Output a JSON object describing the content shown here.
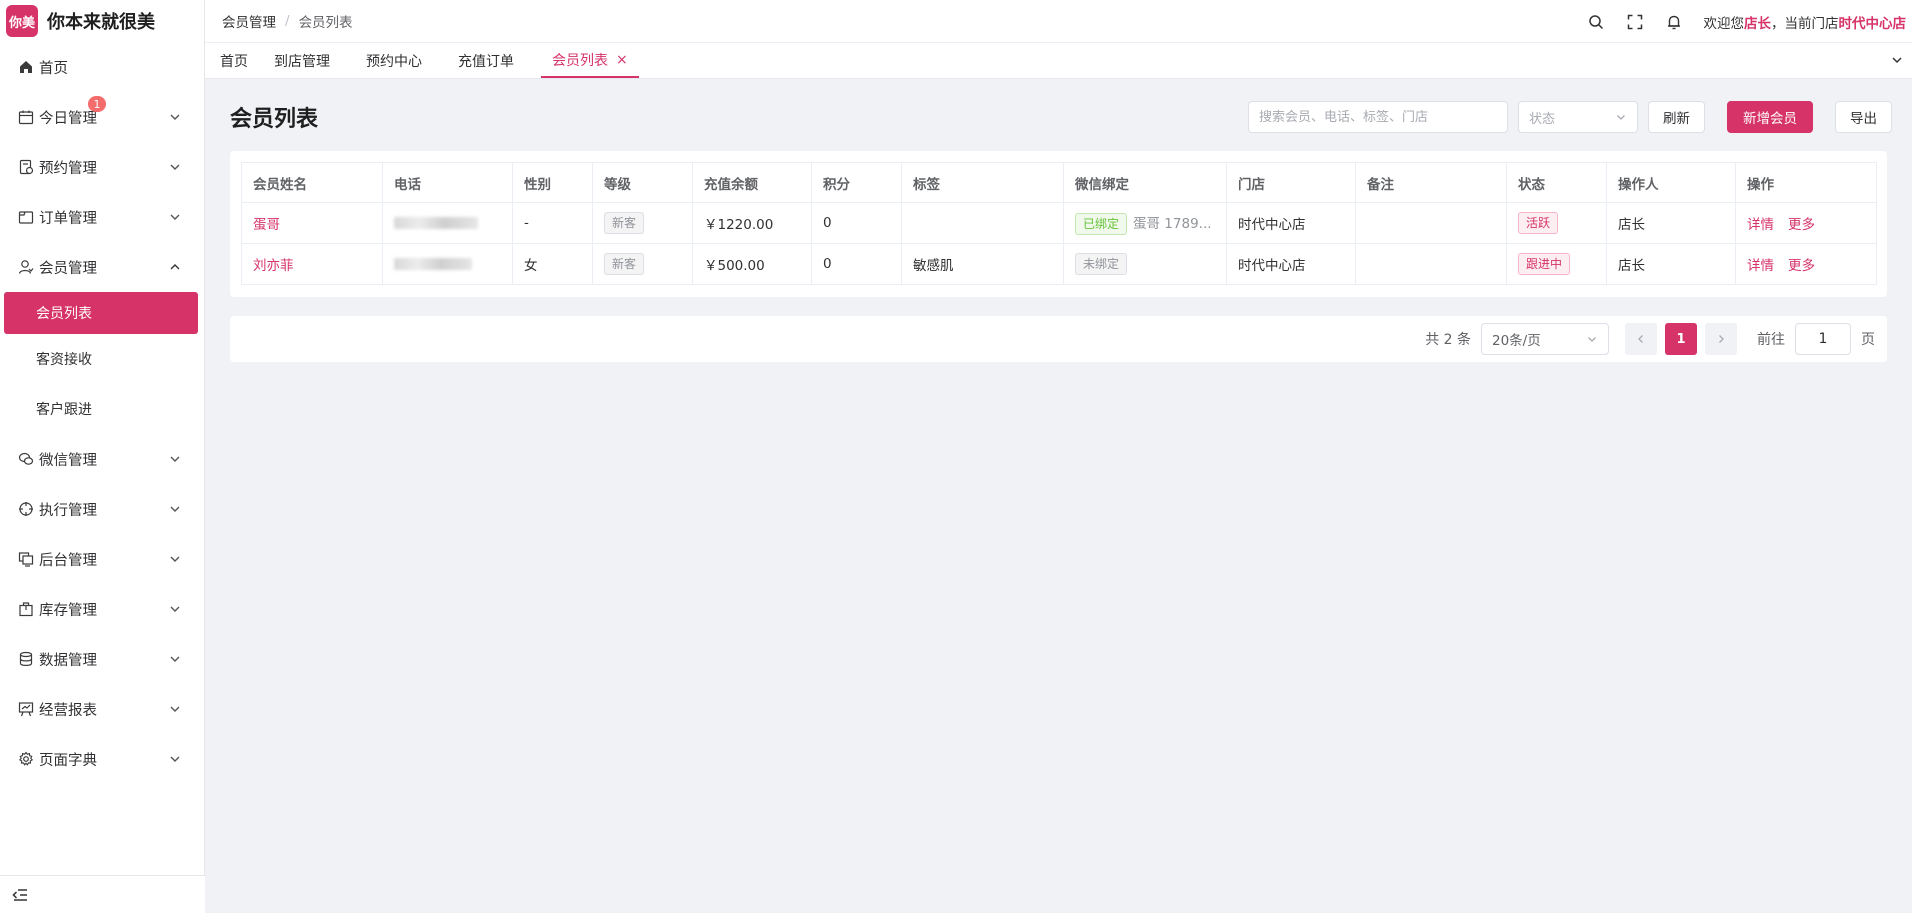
{
  "brand": {
    "logo_text": "你美",
    "name": "你本来就很美"
  },
  "sidebar": {
    "items": [
      {
        "label": "首页",
        "icon": "home-icon"
      },
      {
        "label": "今日管理",
        "icon": "calendar-icon",
        "badge": "1"
      },
      {
        "label": "预约管理",
        "icon": "appointment-icon"
      },
      {
        "label": "订单管理",
        "icon": "order-icon"
      },
      {
        "label": "会员管理",
        "icon": "user-icon",
        "expanded": true,
        "children": [
          {
            "label": "会员列表",
            "active": true
          },
          {
            "label": "客资接收"
          },
          {
            "label": "客户跟进"
          }
        ]
      },
      {
        "label": "微信管理",
        "icon": "wechat-icon"
      },
      {
        "label": "执行管理",
        "icon": "target-icon"
      },
      {
        "label": "后台管理",
        "icon": "monitor-icon"
      },
      {
        "label": "库存管理",
        "icon": "box-icon"
      },
      {
        "label": "数据管理",
        "icon": "database-icon"
      },
      {
        "label": "经营报表",
        "icon": "report-icon"
      },
      {
        "label": "页面字典",
        "icon": "settings-icon"
      }
    ]
  },
  "header": {
    "breadcrumb": [
      "会员管理",
      "会员列表"
    ],
    "breadcrumb_sep": "/",
    "welcome_prefix": "欢迎您",
    "user": "店长",
    "welcome_mid": "，当前门店",
    "store": "时代中心店"
  },
  "tabs": [
    {
      "label": "首页"
    },
    {
      "label": "到店管理"
    },
    {
      "label": "预约中心"
    },
    {
      "label": "充值订单"
    },
    {
      "label": "会员列表",
      "active": true,
      "close": "×"
    }
  ],
  "page": {
    "title": "会员列表",
    "search_placeholder": "搜索会员、电话、标签、门店",
    "status_placeholder": "状态",
    "refresh_label": "刷新",
    "add_label": "新增会员",
    "export_label": "导出"
  },
  "table": {
    "columns": [
      "会员姓名",
      "电话",
      "性别",
      "等级",
      "充值余额",
      "积分",
      "标签",
      "微信绑定",
      "门店",
      "备注",
      "状态",
      "操作人",
      "操作"
    ],
    "rows": [
      {
        "name": "蛋哥",
        "gender": "-",
        "level": "新客",
        "balance": "￥1220.00",
        "points": "0",
        "tag": "",
        "wx_status": "已绑定",
        "wx_name": "蛋哥 1789...",
        "store": "时代中心店",
        "note": "",
        "status": "活跃",
        "operator": "店长",
        "op_detail": "详情",
        "op_more": "更多"
      },
      {
        "name": "刘亦菲",
        "gender": "女",
        "level": "新客",
        "balance": "￥500.00",
        "points": "0",
        "tag": "敏感肌",
        "wx_status": "未绑定",
        "wx_name": "",
        "store": "时代中心店",
        "note": "",
        "status": "跟进中",
        "operator": "店长",
        "op_detail": "详情",
        "op_more": "更多"
      }
    ]
  },
  "pager": {
    "total": "共 2 条",
    "page_size": "20条/页",
    "current": "1",
    "goto_label": "前往",
    "goto_value": "1",
    "goto_suffix": "页"
  },
  "colors": {
    "accent": "#d63368",
    "badge": "#f56c6c"
  }
}
